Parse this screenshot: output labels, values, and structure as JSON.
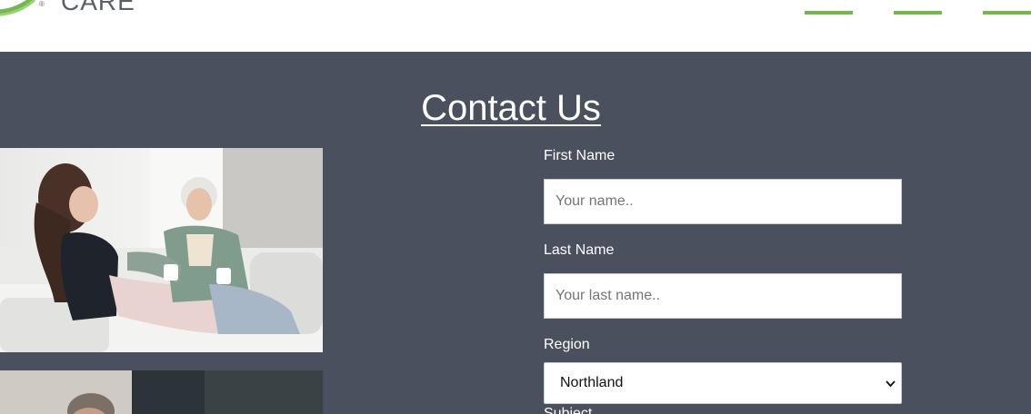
{
  "header": {
    "logo_text": "CARE",
    "logo_mark": "®",
    "menu_icon": "hamburger-menu-icon"
  },
  "main": {
    "title": "Contact Us",
    "form": {
      "first_name": {
        "label": "First Name",
        "placeholder": "Your name..",
        "value": ""
      },
      "last_name": {
        "label": "Last Name",
        "placeholder": "Your last name..",
        "value": ""
      },
      "region": {
        "label": "Region",
        "selected": "Northland"
      },
      "subject": {
        "label": "Subject"
      }
    }
  },
  "colors": {
    "page_bg": "#4a505d",
    "accent_green": "#72b84f",
    "header_bg": "#ffffff",
    "text_light": "#ffffff"
  }
}
